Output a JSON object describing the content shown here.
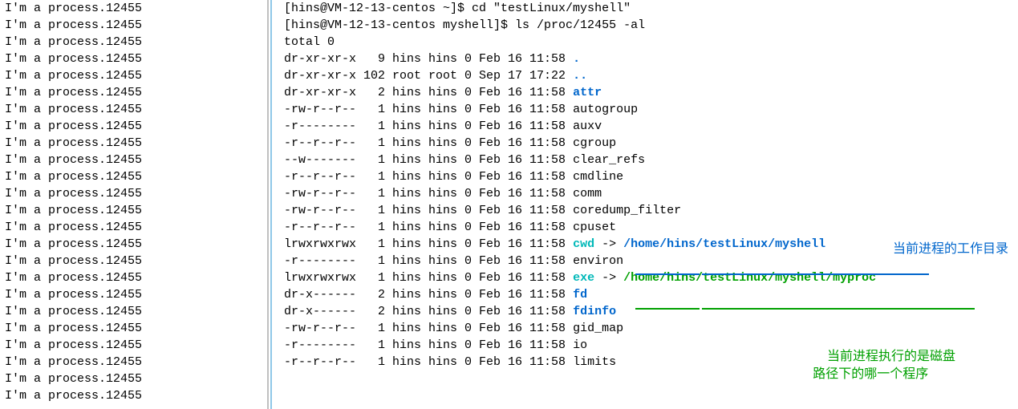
{
  "process_line": "I'm a process.12455",
  "left_lines_count": 24,
  "terminal": {
    "prompt1": "[hins@VM-12-13-centos ~]$ ",
    "cmd1": "cd \"testLinux/myshell\"",
    "prompt2": "[hins@VM-12-13-centos myshell]$ ",
    "cmd2": "ls /proc/12455 -al",
    "total": "total 0",
    "listing": [
      {
        "perm": "dr-xr-xr-x",
        "n": "  9",
        "ug": "hins hins",
        "sz": "0",
        "date": "Feb 16 11:58",
        "name": ".",
        "cls": "c-blue"
      },
      {
        "perm": "dr-xr-xr-x",
        "n": "102",
        "ug": "root root",
        "sz": "0",
        "date": "Sep 17 17:22",
        "name": "..",
        "cls": "c-blue"
      },
      {
        "perm": "dr-xr-xr-x",
        "n": "  2",
        "ug": "hins hins",
        "sz": "0",
        "date": "Feb 16 11:58",
        "name": "attr",
        "cls": "c-blue"
      },
      {
        "perm": "-rw-r--r--",
        "n": "  1",
        "ug": "hins hins",
        "sz": "0",
        "date": "Feb 16 11:58",
        "name": "autogroup",
        "cls": ""
      },
      {
        "perm": "-r--------",
        "n": "  1",
        "ug": "hins hins",
        "sz": "0",
        "date": "Feb 16 11:58",
        "name": "auxv",
        "cls": ""
      },
      {
        "perm": "-r--r--r--",
        "n": "  1",
        "ug": "hins hins",
        "sz": "0",
        "date": "Feb 16 11:58",
        "name": "cgroup",
        "cls": ""
      },
      {
        "perm": "--w-------",
        "n": "  1",
        "ug": "hins hins",
        "sz": "0",
        "date": "Feb 16 11:58",
        "name": "clear_refs",
        "cls": ""
      },
      {
        "perm": "-r--r--r--",
        "n": "  1",
        "ug": "hins hins",
        "sz": "0",
        "date": "Feb 16 11:58",
        "name": "cmdline",
        "cls": ""
      },
      {
        "perm": "-rw-r--r--",
        "n": "  1",
        "ug": "hins hins",
        "sz": "0",
        "date": "Feb 16 11:58",
        "name": "comm",
        "cls": ""
      },
      {
        "perm": "-rw-r--r--",
        "n": "  1",
        "ug": "hins hins",
        "sz": "0",
        "date": "Feb 16 11:58",
        "name": "coredump_filter",
        "cls": ""
      },
      {
        "perm": "-r--r--r--",
        "n": "  1",
        "ug": "hins hins",
        "sz": "0",
        "date": "Feb 16 11:58",
        "name": "cpuset",
        "cls": ""
      },
      {
        "perm": "lrwxrwxrwx",
        "n": "  1",
        "ug": "hins hins",
        "sz": "0",
        "date": "Feb 16 11:58",
        "name": "cwd",
        "cls": "c-cyan",
        "arrow": " -> ",
        "target": "/home/hins/testLinux/myshell",
        "tcls": "c-blue"
      },
      {
        "perm": "-r--------",
        "n": "  1",
        "ug": "hins hins",
        "sz": "0",
        "date": "Feb 16 11:58",
        "name": "environ",
        "cls": ""
      },
      {
        "perm": "lrwxrwxrwx",
        "n": "  1",
        "ug": "hins hins",
        "sz": "0",
        "date": "Feb 16 11:58",
        "name": "exe",
        "cls": "c-cyan",
        "arrow": " -> ",
        "target": "/home/hins/testLinux/myshell/myproc",
        "tcls": "c-green"
      },
      {
        "perm": "dr-x------",
        "n": "  2",
        "ug": "hins hins",
        "sz": "0",
        "date": "Feb 16 11:58",
        "name": "fd",
        "cls": "c-blue"
      },
      {
        "perm": "dr-x------",
        "n": "  2",
        "ug": "hins hins",
        "sz": "0",
        "date": "Feb 16 11:58",
        "name": "fdinfo",
        "cls": "c-blue"
      },
      {
        "perm": "-rw-r--r--",
        "n": "  1",
        "ug": "hins hins",
        "sz": "0",
        "date": "Feb 16 11:58",
        "name": "gid_map",
        "cls": ""
      },
      {
        "perm": "-r--------",
        "n": "  1",
        "ug": "hins hins",
        "sz": "0",
        "date": "Feb 16 11:58",
        "name": "io",
        "cls": ""
      },
      {
        "perm": "-r--r--r--",
        "n": "  1",
        "ug": "hins hins",
        "sz": "0",
        "date": "Feb 16 11:58",
        "name": "limits",
        "cls": ""
      }
    ]
  },
  "annotations": {
    "cwd": "当前进程的工作目录",
    "exe_l1": "当前进程执行的是磁盘",
    "exe_l2": "路径下的哪一个程序"
  }
}
